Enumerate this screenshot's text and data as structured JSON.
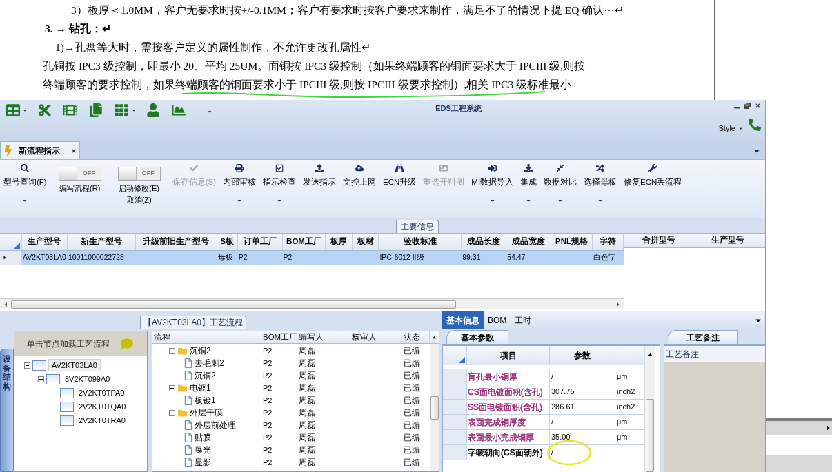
{
  "document": {
    "lines": [
      {
        "kind": "sub_item",
        "text": "3）板厚＜1.0MM，客户无要求时按+/-0.1MM；客户有要求时按客户要求来制作，满足不了的情况下提 EQ 确认···↵"
      },
      {
        "kind": "heading",
        "text": "3. → 钻孔：↵"
      },
      {
        "kind": "numbered",
        "text": "1)→孔盘等大时，需按客户定义的属性制作，不允许更改孔属性↵"
      },
      {
        "kind": "body",
        "text": "孔铜按 IPC3 级控制，即最小 20、平均 25UM。面铜按 IPC3 级控制（如果终端顾客的铜面要求大于 IPCIII 级,则按"
      },
      {
        "kind": "body",
        "text": "终端顾客的要求控制，如果终端顾客的铜面要求小于 IPCIII 级,则按 IPCIII 级要求控制）,相关 IPC3 级标准最小"
      }
    ]
  },
  "window": {
    "title": "EDS工程系统",
    "style_menu": "Style"
  },
  "tabs": [
    {
      "label": "新流程指示",
      "selected": true
    }
  ],
  "toolbar": [
    {
      "kind": "button",
      "label": "型号查询(F)",
      "disabled": false,
      "dropdown": true
    },
    {
      "kind": "toggle",
      "label": "编写流程(R)",
      "state_text": "OFF",
      "on": false
    },
    {
      "kind": "toggle",
      "label": "启动修改(E)",
      "sub_label": "取消(Z)",
      "state_text": "OFF",
      "on": false
    },
    {
      "kind": "button",
      "label": "保存信息(S)",
      "disabled": true,
      "dropdown": false
    },
    {
      "kind": "button",
      "label": "内部审核",
      "disabled": false,
      "dropdown": true
    },
    {
      "kind": "button",
      "label": "指示检查",
      "disabled": false,
      "dropdown": true
    },
    {
      "kind": "button",
      "label": "发送指示",
      "disabled": false,
      "dropdown": false
    },
    {
      "kind": "button",
      "label": "文控上网",
      "disabled": false,
      "dropdown": false
    },
    {
      "kind": "button",
      "label": "ECN升级",
      "disabled": false,
      "dropdown": false
    },
    {
      "kind": "button",
      "label": "重选开料图",
      "disabled": true,
      "dropdown": false
    },
    {
      "kind": "button",
      "label": "MI数据导入",
      "disabled": false,
      "dropdown": true
    },
    {
      "kind": "button",
      "label": "集成",
      "disabled": false,
      "dropdown": true
    },
    {
      "kind": "button",
      "label": "数据对比",
      "disabled": false,
      "dropdown": true
    },
    {
      "kind": "button",
      "label": "选择母板",
      "disabled": false,
      "dropdown": true
    },
    {
      "kind": "button",
      "label": "修复ECN丢流程",
      "disabled": false,
      "dropdown": false
    }
  ],
  "main_info": {
    "title": "主要信息",
    "columns": [
      "生产型号",
      "新生产型号",
      "升级前旧生产型号",
      "S板",
      "订单工厂",
      "BOM工厂",
      "板厚",
      "板材",
      "验收标准",
      "成品长度",
      "成品宽度",
      "PNL规格",
      "字符"
    ],
    "rows": [
      {
        "selected": true,
        "cells": [
          "AV2KT03LA0",
          "10011000022728",
          "",
          "母板",
          "P2",
          "P2",
          "",
          "",
          "IPC-6012 II级",
          "99.31",
          "54.47",
          "",
          "白色字"
        ]
      }
    ],
    "side_columns": [
      "合拼型号",
      "生产型号"
    ]
  },
  "process": {
    "title": "【AV2KT03LA0】工艺流程",
    "side_tab": "设备结构",
    "hint": "单击节点加载工艺流程",
    "device_tree": [
      {
        "label": "AV2KT03LA0",
        "selected": true,
        "expanded": true,
        "children": [
          {
            "label": "8V2KT099A0",
            "selected": false,
            "expanded": true,
            "children": [
              {
                "label": "2V2KT0TPA0",
                "selected": false
              },
              {
                "label": "2V2KT0TQA0",
                "selected": false
              },
              {
                "label": "2V2KT0TRA0",
                "selected": false
              }
            ]
          }
        ]
      }
    ],
    "columns": [
      "流程",
      "BOM工厂",
      "编写人",
      "核审人",
      "状态"
    ],
    "rows": [
      {
        "kind": "folder",
        "name": "沉铜2",
        "bom": "P2",
        "writer": "周磊",
        "status": "已编",
        "expanded": true,
        "children": [
          {
            "kind": "step",
            "name": "去毛刺2",
            "bom": "P2",
            "writer": "周磊",
            "status": "已编"
          },
          {
            "kind": "step",
            "name": "沉铜2",
            "bom": "P2",
            "writer": "周磊",
            "status": "已编"
          }
        ]
      },
      {
        "kind": "folder",
        "name": "电镀1",
        "bom": "P2",
        "writer": "周磊",
        "status": "已编",
        "expanded": true,
        "children": [
          {
            "kind": "step",
            "name": "板镀1",
            "bom": "P2",
            "writer": "周磊",
            "status": "已编"
          }
        ]
      },
      {
        "kind": "folder",
        "name": "外层干膜",
        "bom": "P2",
        "writer": "周磊",
        "status": "已编",
        "expanded": true,
        "children": [
          {
            "kind": "step",
            "name": "外层前处理",
            "bom": "P2",
            "writer": "周磊",
            "status": "已编"
          },
          {
            "kind": "step",
            "name": "贴膜",
            "bom": "P2",
            "writer": "周磊",
            "status": "已编"
          },
          {
            "kind": "step",
            "name": "曝光",
            "bom": "P2",
            "writer": "周磊",
            "status": "已编"
          },
          {
            "kind": "step",
            "name": "显影",
            "bom": "P2",
            "writer": "周磊",
            "status": "已编"
          }
        ]
      }
    ]
  },
  "detail": {
    "tabs": [
      {
        "label": "基本信息",
        "selected": true
      },
      {
        "label": "BOM",
        "selected": false
      },
      {
        "label": "工时",
        "selected": false
      }
    ],
    "param_tab": "基本参数",
    "columns": [
      "项目",
      "参数"
    ],
    "rows": [
      {
        "item": "盲孔最小铜厚",
        "value": "/",
        "unit": "μm",
        "color": "#a02c7c"
      },
      {
        "item": "CS面电镀面积(含孔)",
        "value": "307.75",
        "unit": "inch2",
        "color": "#a02c7c"
      },
      {
        "item": "SS面电镀面积(含孔)",
        "value": "286.61",
        "unit": "inch2",
        "color": "#a02c7c"
      },
      {
        "item": "表面完成铜厚度",
        "value": "/",
        "unit": "μm",
        "color": "#a02c7c"
      },
      {
        "item": "表面最小完成铜厚",
        "value": "35.00",
        "unit": "μm",
        "color": "#a02c7c"
      },
      {
        "item": "字唛朝向(CS面朝外)",
        "value": "/",
        "color": "#000000"
      }
    ],
    "remark_tab": "工艺备注",
    "remark_label": "工艺备注"
  }
}
